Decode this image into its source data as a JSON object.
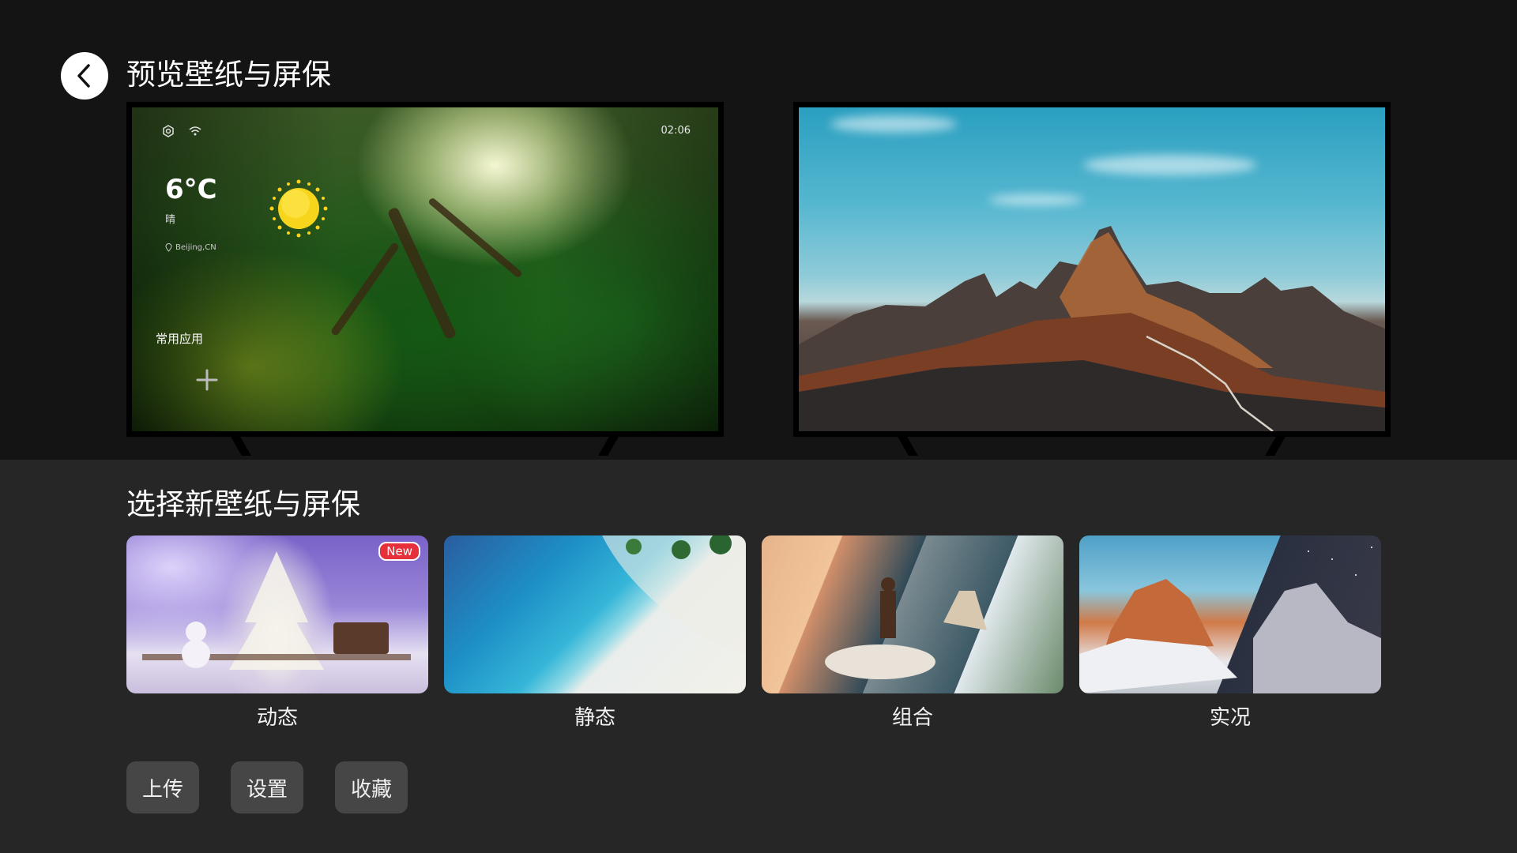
{
  "header": {
    "title": "预览壁纸与屏保"
  },
  "preview_home": {
    "clock": "02:06",
    "weather": {
      "temperature": "6°C",
      "condition": "晴",
      "location": "Beijing,CN"
    },
    "apps_label": "常用应用"
  },
  "picker": {
    "title": "选择新壁纸与屏保",
    "categories": [
      {
        "label": "动态",
        "badge": "New"
      },
      {
        "label": "静态"
      },
      {
        "label": "组合"
      },
      {
        "label": "实况"
      }
    ]
  },
  "actions": {
    "upload": "上传",
    "settings": "设置",
    "favorites": "收藏"
  },
  "icons": [
    "back-arrow-icon",
    "settings-icon",
    "wifi-icon",
    "sun-icon",
    "location-pin-icon",
    "plus-icon"
  ],
  "colors": {
    "background_top": "#141414",
    "background_bottom": "#262626",
    "button": "#464646",
    "badge": "#e6303a"
  }
}
